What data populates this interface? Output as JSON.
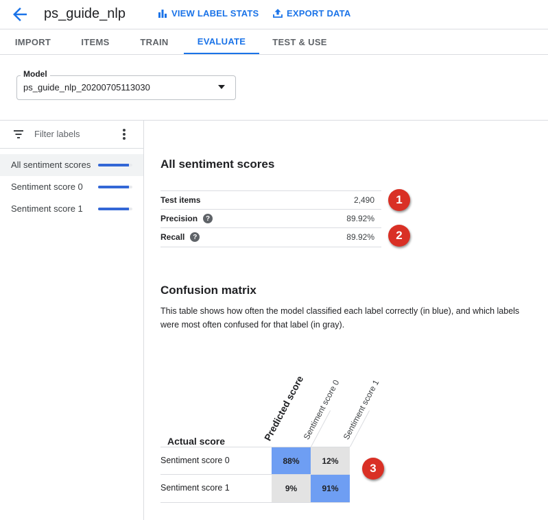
{
  "header": {
    "title": "ps_guide_nlp",
    "view_label_stats": "VIEW LABEL STATS",
    "export_data": "EXPORT DATA",
    "accent_color": "#1a73e8"
  },
  "tabs": [
    {
      "label": "IMPORT"
    },
    {
      "label": "ITEMS"
    },
    {
      "label": "TRAIN"
    },
    {
      "label": "EVALUATE",
      "active": true
    },
    {
      "label": "TEST & USE"
    }
  ],
  "model": {
    "label": "Model",
    "value": "ps_guide_nlp_20200705113030"
  },
  "sidebar": {
    "filter_placeholder": "Filter labels",
    "items": [
      {
        "label": "All sentiment scores",
        "selected": true,
        "bar_fraction": 0.9
      },
      {
        "label": "Sentiment score 0",
        "selected": false,
        "bar_fraction": 0.9
      },
      {
        "label": "Sentiment score 1",
        "selected": false,
        "bar_fraction": 0.9
      }
    ]
  },
  "summary": {
    "title": "All sentiment scores",
    "metrics": [
      {
        "name": "Test items",
        "value": "2,490",
        "help": false
      },
      {
        "name": "Precision",
        "value": "89.92%",
        "help": true
      },
      {
        "name": "Recall",
        "value": "89.92%",
        "help": true
      }
    ]
  },
  "callouts": [
    "1",
    "2",
    "3"
  ],
  "confusion_matrix": {
    "title": "Confusion matrix",
    "description": "This table shows how often the model classified each label correctly (in blue), and which labels were most often confused for that label (in gray).",
    "actual_header": "Actual score",
    "predicted_header": "Predicted score",
    "columns": [
      "Sentiment score 0",
      "Sentiment score 1"
    ],
    "rows": [
      {
        "label": "Sentiment score 0",
        "cells": [
          "88%",
          "12%"
        ],
        "correct_index": 0
      },
      {
        "label": "Sentiment score 1",
        "cells": [
          "9%",
          "91%"
        ],
        "correct_index": 1
      }
    ],
    "correct_color": "#6e9ef3",
    "confused_color": "#e3e3e3"
  }
}
